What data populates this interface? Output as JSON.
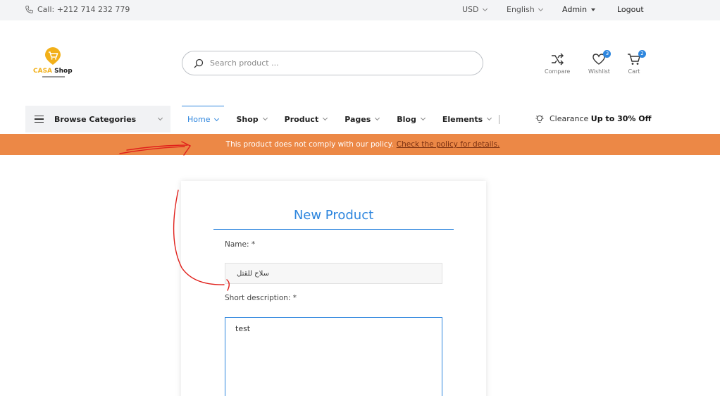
{
  "topbar": {
    "phone": "Call: +212 714 232 779",
    "currency": "USD",
    "language": "English",
    "account": "Admin",
    "logout": "Logout"
  },
  "brand": {
    "name_part1": "CASA",
    "name_part2": "Shop",
    "accent": "#f2b019"
  },
  "search": {
    "placeholder": "Search product ..."
  },
  "header_icons": {
    "compare": "Compare",
    "wishlist": "Wishlist",
    "wishlist_count": "3",
    "cart": "Cart",
    "cart_count": "2"
  },
  "nav": {
    "browse": "Browse Categories",
    "items": [
      {
        "label": "Home",
        "active": true
      },
      {
        "label": "Shop"
      },
      {
        "label": "Product"
      },
      {
        "label": "Pages"
      },
      {
        "label": "Blog"
      },
      {
        "label": "Elements"
      }
    ],
    "clearance_prefix": "Clearance",
    "clearance_offer": "Up to 30% Off"
  },
  "alert": {
    "message": "This product does not comply with our policy.",
    "link": "Check the policy for details.",
    "color": "#ec8846"
  },
  "form": {
    "title": "New Product",
    "name_label": "Name: *",
    "name_value": "سلاح للقتل",
    "description_label": "Short description: *",
    "description_value": "test"
  },
  "colors": {
    "primary": "#2e86de",
    "annotation": "#e0201b"
  }
}
